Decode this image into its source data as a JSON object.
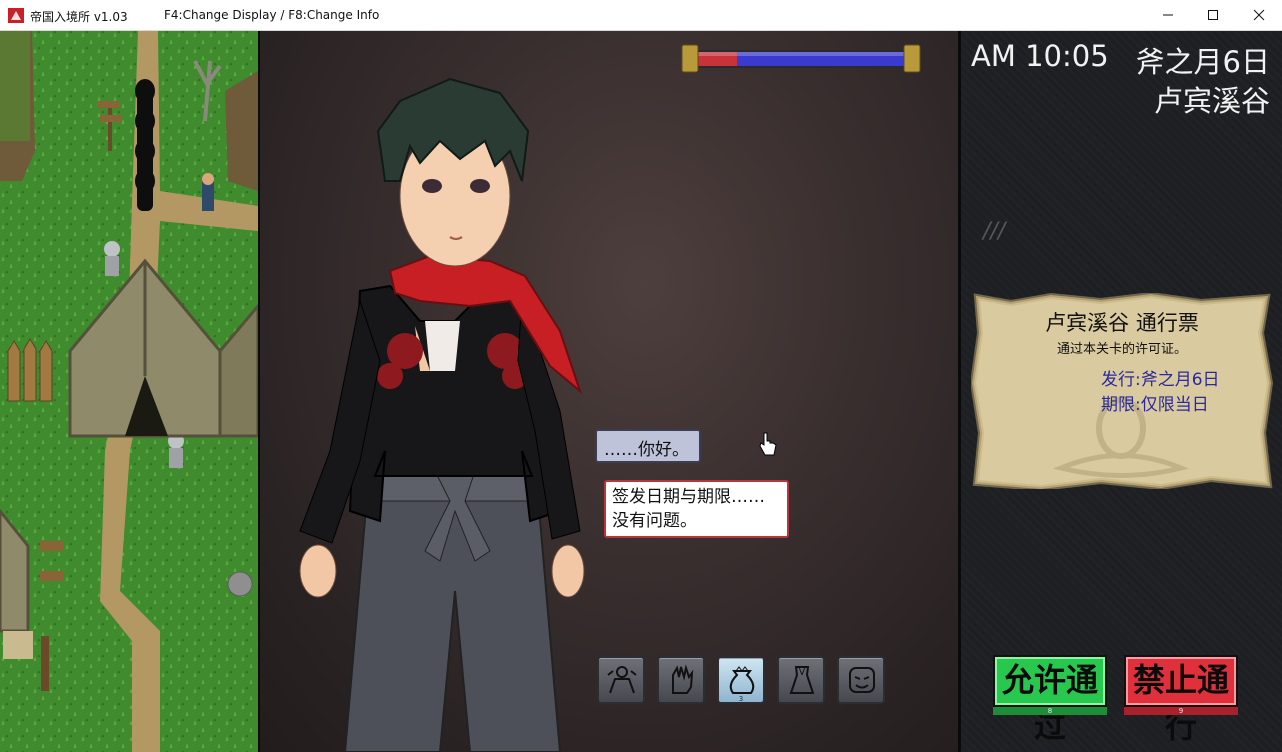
{
  "window": {
    "title": "帝国入境所 v1.03",
    "hint": "F4:Change Display / F8:Change Info",
    "controls": [
      "minimize",
      "maximize",
      "close"
    ]
  },
  "hud": {
    "time": "AM 10:05",
    "date": "斧之月6日",
    "location": "卢宾溪谷",
    "tally": "///"
  },
  "pass": {
    "title": "卢宾溪谷 通行票",
    "description": "通过本关卡的许可证。",
    "issued": "发行:斧之月6日",
    "expiry": "期限:仅限当日",
    "emblem": "cobra-emblem"
  },
  "gauge": {
    "red_fraction": 0.19,
    "colors": {
      "red": "#c8323a",
      "blue": "#3a3ad0",
      "frame": "#b89a3a"
    }
  },
  "dialogue": [
    {
      "speaker": "traveler",
      "text": "……你好。"
    },
    {
      "speaker": "player",
      "lines": [
        "签发日期与期限……",
        "没有问题。"
      ]
    }
  ],
  "actions": [
    {
      "name": "gesture",
      "icon": "gesture-icon",
      "count": ""
    },
    {
      "name": "glove",
      "icon": "glove-icon",
      "count": ""
    },
    {
      "name": "bag",
      "icon": "bag-icon",
      "count": "3",
      "active": true
    },
    {
      "name": "clothes",
      "icon": "clothes-icon",
      "count": ""
    },
    {
      "name": "face",
      "icon": "mask-icon",
      "count": ""
    }
  ],
  "decisions": {
    "approve": {
      "label": "允许通过",
      "key": "8",
      "color": "#28c84e"
    },
    "deny": {
      "label": "禁止通行",
      "key": "9",
      "color": "#e0303c"
    }
  }
}
